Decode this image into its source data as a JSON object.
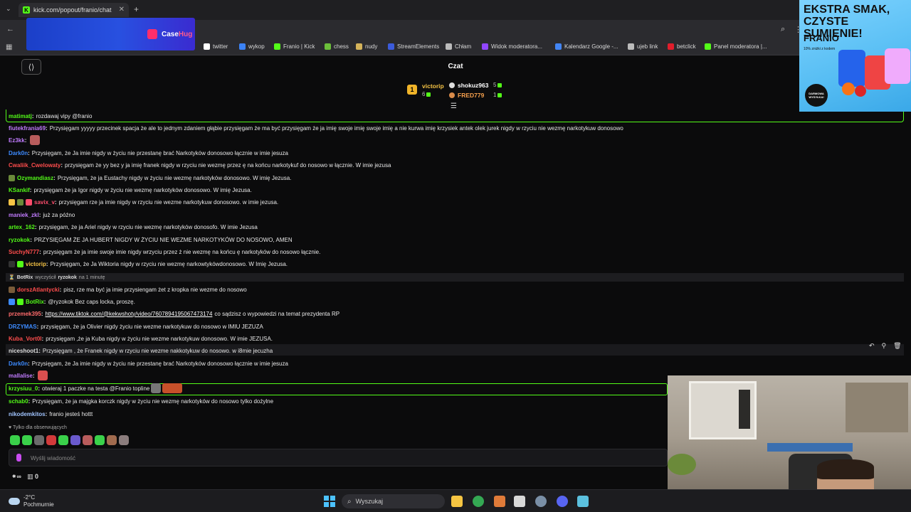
{
  "browser": {
    "tab_title": "kick.com/popout/franio/chat",
    "tab_close": "✕",
    "new_tab": "+",
    "tab_menu": "⌄",
    "back": "←",
    "search_icon": "⌕",
    "menu_icon": "⋮",
    "bookmarks": [
      {
        "label": "twitter",
        "icon": "x-icon",
        "color": "#ffffff"
      },
      {
        "label": "wykop",
        "icon": "wykop-icon",
        "color": "#3b82f6"
      },
      {
        "label": "Franio | Kick",
        "icon": "kick-icon",
        "color": "#53fc18"
      },
      {
        "label": "chess",
        "icon": "chess-icon",
        "color": "#6bbf3a"
      },
      {
        "label": "nudy",
        "icon": "folder-icon",
        "color": "#d4b35a"
      },
      {
        "label": "StreamElements",
        "icon": "streamelements-icon",
        "color": "#3b5bdb"
      },
      {
        "label": "Chłam",
        "icon": "globe-icon",
        "color": "#bbbbbb"
      },
      {
        "label": "Widok moderatora...",
        "icon": "twitch-icon",
        "color": "#9146ff"
      },
      {
        "label": "Kalendarz Google -...",
        "icon": "calendar-icon",
        "color": "#4285f4"
      },
      {
        "label": "ujeb link",
        "icon": "globe-icon",
        "color": "#bbbbbb"
      },
      {
        "label": "betclick",
        "icon": "betclic-icon",
        "color": "#e11d2b"
      },
      {
        "label": "Panel moderatora |...",
        "icon": "kick-icon",
        "color": "#53fc18"
      }
    ]
  },
  "banner_ad": {
    "brand_1": "Case",
    "brand_2": "Hug"
  },
  "chat": {
    "title": "Czat",
    "leaderboard": {
      "first": {
        "rank": "1",
        "name": "victorip",
        "count": "6"
      },
      "second": {
        "name": "shokuz963",
        "count": "5"
      },
      "third": {
        "name": "FRED779",
        "count": "1"
      }
    },
    "messages": [
      {
        "user": "matimatj",
        "color": "#53fc18",
        "text": "rozdawaj vipy @franio"
      },
      {
        "user": "fiutekfrania69",
        "color": "#c17bff",
        "text": "Przysięgam yyyyy przecinek spacja że ale to jednym zdaniem głąbie przysięgam że ma być przysięgam że ja imię swoje imię swoje imię a nie kurwa imię krzysiek antek olek jurek nigdy w rzyciu nie wezmę narkotykuw donosowo"
      },
      {
        "user": "Ez3kk",
        "color": "#c17bff",
        "text": ""
      },
      {
        "user": "Dark0n",
        "color": "#3d8bff",
        "text": "Przysięgam, że Ja imie nigdy w życiu nie przestanę brać Narkotyków donosowo łącznie w imie jesuza"
      },
      {
        "user": "Cwaliik_Cwelowaty",
        "color": "#ff4d4d",
        "text": "przysięgam że yy bez y ja imię franek nigdy w rzyciu nie wezmę przez ę na końcu narkotykuf do nosowo w łącznie. W imie jezusa"
      },
      {
        "user": "Ozymandiasz",
        "color": "#53fc18",
        "text": "Przysięgam, że ja Eustachy nigdy w życiu nie wezmę narkotyków donosowo. W imię Jezusa."
      },
      {
        "user": "KSankif",
        "color": "#53fc18",
        "text": "przysięgam że ja Igor nigdy w życiu nie wezmę narkotyków donosowo. W imię Jezusa."
      },
      {
        "user": "savix_v",
        "color": "#ff4d6d",
        "text": "przysięgam rze ja imie nigdy w rzyciu nie wezme narkotykuw donosowo. w imie jezusa."
      },
      {
        "user": "maniek_zkl",
        "color": "#c17bff",
        "text": "już za późno"
      },
      {
        "user": "artex_162",
        "color": "#53fc18",
        "text": "przysięgam, że ja Ariel nigdy w rzyciu nie wezmę narkotyków donosofo. W imie Jezusa"
      },
      {
        "user": "ryzokok",
        "color": "#53fc18",
        "text": "PRZYSIĘGAM ŻE JA HUBERT NIGDY W ŻYCIU NIE WEZME NARKOTYKÓW DO NOSOWO, AMEN"
      },
      {
        "user": "SuchyN777",
        "color": "#ff4d4d",
        "text": "przysięgam że ja imie swoje imie nigdy wrzyciu przez ż nie wezmę na końcu ę narkotyków do nosowo łącznie."
      },
      {
        "user": "victorip",
        "color": "#f6c445",
        "text": "Przysięgam, że Ja Wiktoria nigdy w rzyciu nie wezmę narkowtykówdonosowo. W Imię Jezusa."
      },
      {
        "system": true,
        "user": "BotRix",
        "action": "wyczyścił",
        "target": "ryzokok",
        "duration": "na 1 minutę"
      },
      {
        "user": "dorszAtlantycki",
        "color": "#ff4d4d",
        "text": "pisz, rze ma być ja imie przysiengam żet z kropka nie wezme do nosowo"
      },
      {
        "user": "BotRix",
        "color": "#53fc18",
        "text": "@ryzokok Bez caps locka, proszę."
      },
      {
        "user": "przemek395",
        "color": "#ff6b6b",
        "link": "https://www.tiktok.com/@kekwshoty/video/7607894195067473174",
        "text": "co sądzisz o wypowiedzi na temat prezydenta RP"
      },
      {
        "user": "DRZYMAS",
        "color": "#3d8bff",
        "text": "przysięgam, że ja Olivier nigdy życiu nie wezme narkotykuw do nosowo w IMIU JEZUZA"
      },
      {
        "user": "Kuba_Vort0l",
        "color": "#ff4d4d",
        "text": "przysięgam ,że ja Kuba nigdy w życiu nie wezme narkotykuw donosowo. W imie JEZUSA."
      },
      {
        "user": "niceshoot1",
        "color": "#dddddd",
        "text": "Przysięgam , że Franek nigdy w rzyciu nie wezme nakkotykuw do nosowo. w i8mie jecuzha"
      },
      {
        "user": "Dark0n",
        "color": "#3d8bff",
        "text": "Przysięgam, że Ja imie nigdy w życiu nie przestanę brać Narkotyków donosowo łącznie w imie jesuza"
      },
      {
        "user": "mallalise",
        "color": "#c17bff",
        "text": ""
      },
      {
        "user": "krzysiuu_0",
        "color": "#53fc18",
        "text": "otwieraj 1 paczke na testa @Franio topline"
      },
      {
        "user": "schab0",
        "color": "#53fc18",
        "text": "Przysięgam, że ja majgka korczk nigdy w życiu nie wezmę narkotyków do nosowo tylko dożylne"
      },
      {
        "user": "nikodemkitos",
        "color": "#a0c4ff",
        "text": "franio jesteś hottt"
      }
    ],
    "followers_only": "♥ Tylko dla obserwujących",
    "input_placeholder": "Wyślij wiadomość",
    "footer_infinity": "∞",
    "footer_count": "0"
  },
  "right_ad": {
    "headline": "EKSTRA SMAK, CZYSTE SUMIENIE!",
    "brand": "FRANIO",
    "sub": "10% zniżki z kodem",
    "stamp": "DARMOWA WYSYŁKA!"
  },
  "taskbar": {
    "temp": "-2°C",
    "weather": "Pochmurnie",
    "search": "Wyszukaj"
  }
}
